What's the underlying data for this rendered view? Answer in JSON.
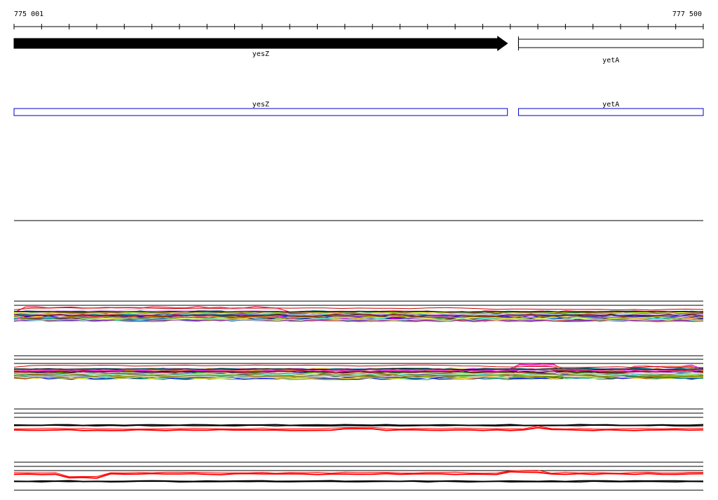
{
  "ruler": {
    "start_label": "775 001",
    "end_label": "777 500",
    "start": 775001,
    "end": 777500
  },
  "genes": [
    {
      "name": "yesZ",
      "start": 775001,
      "end": 776790,
      "strand": "+",
      "fill": "#000000"
    },
    {
      "name": "yetA",
      "start": 776830,
      "end": 777500,
      "strand": "-",
      "fill": "#ffffff"
    }
  ],
  "annotations": [
    {
      "name": "yesZ",
      "start": 775001,
      "end": 776790,
      "color": "#0000cc"
    },
    {
      "name": "yetA",
      "start": 776830,
      "end": 777500,
      "color": "#0000cc"
    }
  ],
  "colors": {
    "palette": [
      "#e6194b",
      "#3cb44b",
      "#ffe119",
      "#4363d8",
      "#f58231",
      "#911eb4",
      "#46f0f0",
      "#f032e6",
      "#bcf60c",
      "#fabebe",
      "#008080",
      "#e6beff",
      "#9a6324",
      "#800000",
      "#aaffc3",
      "#808000",
      "#000075",
      "#808080",
      "#ff0000",
      "#00aa00",
      "#0000ff",
      "#ff00ff",
      "#00cccc",
      "#cc9900"
    ],
    "red": "#ff0000",
    "black": "#000000"
  }
}
